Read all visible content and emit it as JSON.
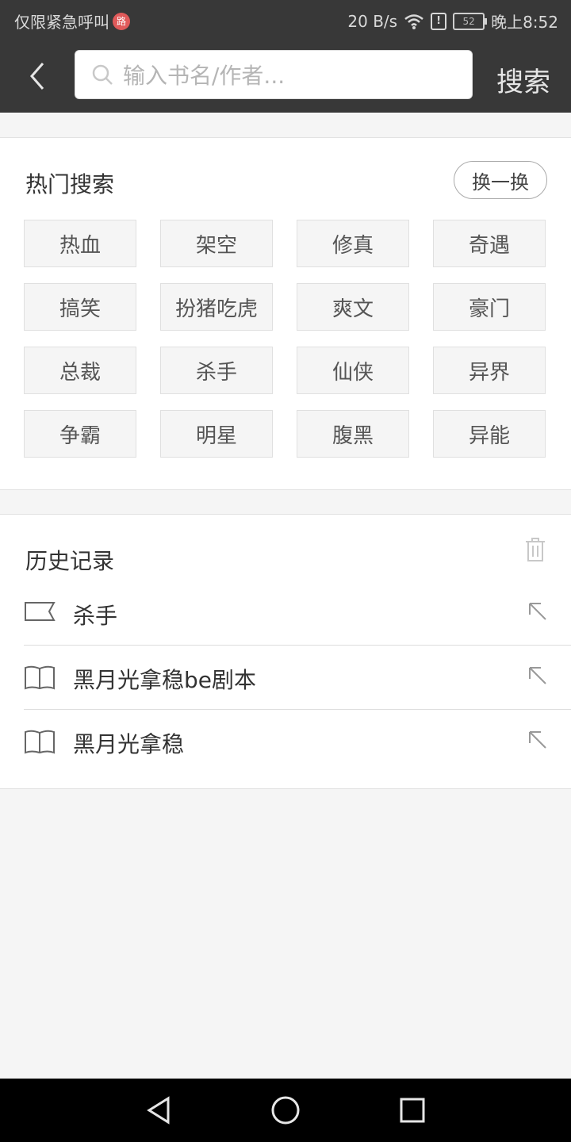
{
  "status_bar": {
    "carrier": "仅限紧急呼叫",
    "badge": "路",
    "speed": "20 B/s",
    "battery": "52",
    "alert": "!",
    "time": "晚上8:52"
  },
  "header": {
    "search_placeholder": "输入书名/作者...",
    "search_label": "搜索"
  },
  "hot_search": {
    "title": "热门搜索",
    "refresh_label": "换一换",
    "tags": [
      "热血",
      "架空",
      "修真",
      "奇遇",
      "搞笑",
      "扮猪吃虎",
      "爽文",
      "豪门",
      "总裁",
      "杀手",
      "仙侠",
      "异界",
      "争霸",
      "明星",
      "腹黑",
      "异能"
    ]
  },
  "history": {
    "title": "历史记录",
    "items": [
      {
        "text": "杀手",
        "icon": "tag-icon"
      },
      {
        "text": "黑月光拿稳be剧本",
        "icon": "book-icon"
      },
      {
        "text": "黑月光拿稳",
        "icon": "book-icon"
      }
    ]
  },
  "colors": {
    "bar_bg": "#383838",
    "page_bg": "#f5f5f5",
    "tag_bg": "#f5f5f5"
  }
}
